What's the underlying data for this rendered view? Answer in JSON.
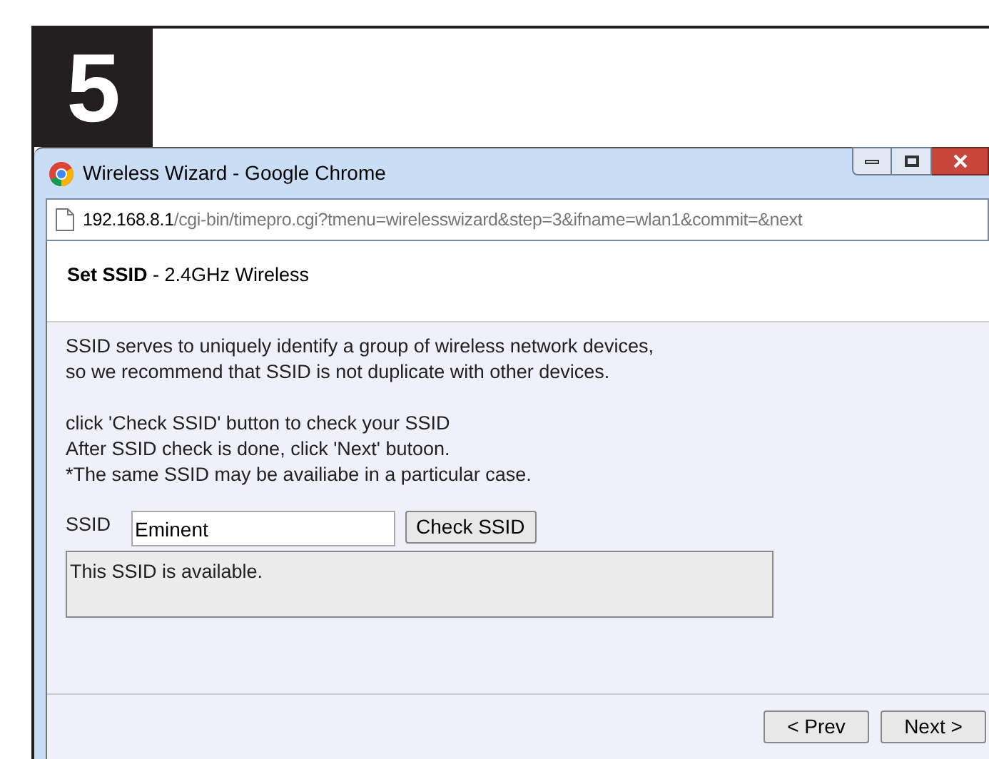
{
  "step": "5",
  "window": {
    "title": "Wireless Wizard - Google Chrome"
  },
  "address_bar": {
    "host": "192.168.8.1",
    "path": "/cgi-bin/timepro.cgi?tmenu=wirelesswizard&step=3&ifname=wlan1&commit=&next"
  },
  "page": {
    "heading": "**Set SSID** - 2.4GHz Wireless",
    "paragraphs": [
      [
        "SSID serves to uniquely identify a group of wireless network devices,",
        "so we recommend that SSID is not duplicate with other devices."
      ],
      [
        "click 'Check SSID' button to check your SSID",
        "After SSID check is done, click 'Next' butoon.",
        "*The same SSID may be availiabe in a particular case."
      ]
    ],
    "ssid": {
      "label": "SSID",
      "value": "Eminent",
      "button": "Check SSID"
    },
    "status": "This SSID is available.",
    "buttons": [
      "< Prev",
      "Next >"
    ]
  }
}
